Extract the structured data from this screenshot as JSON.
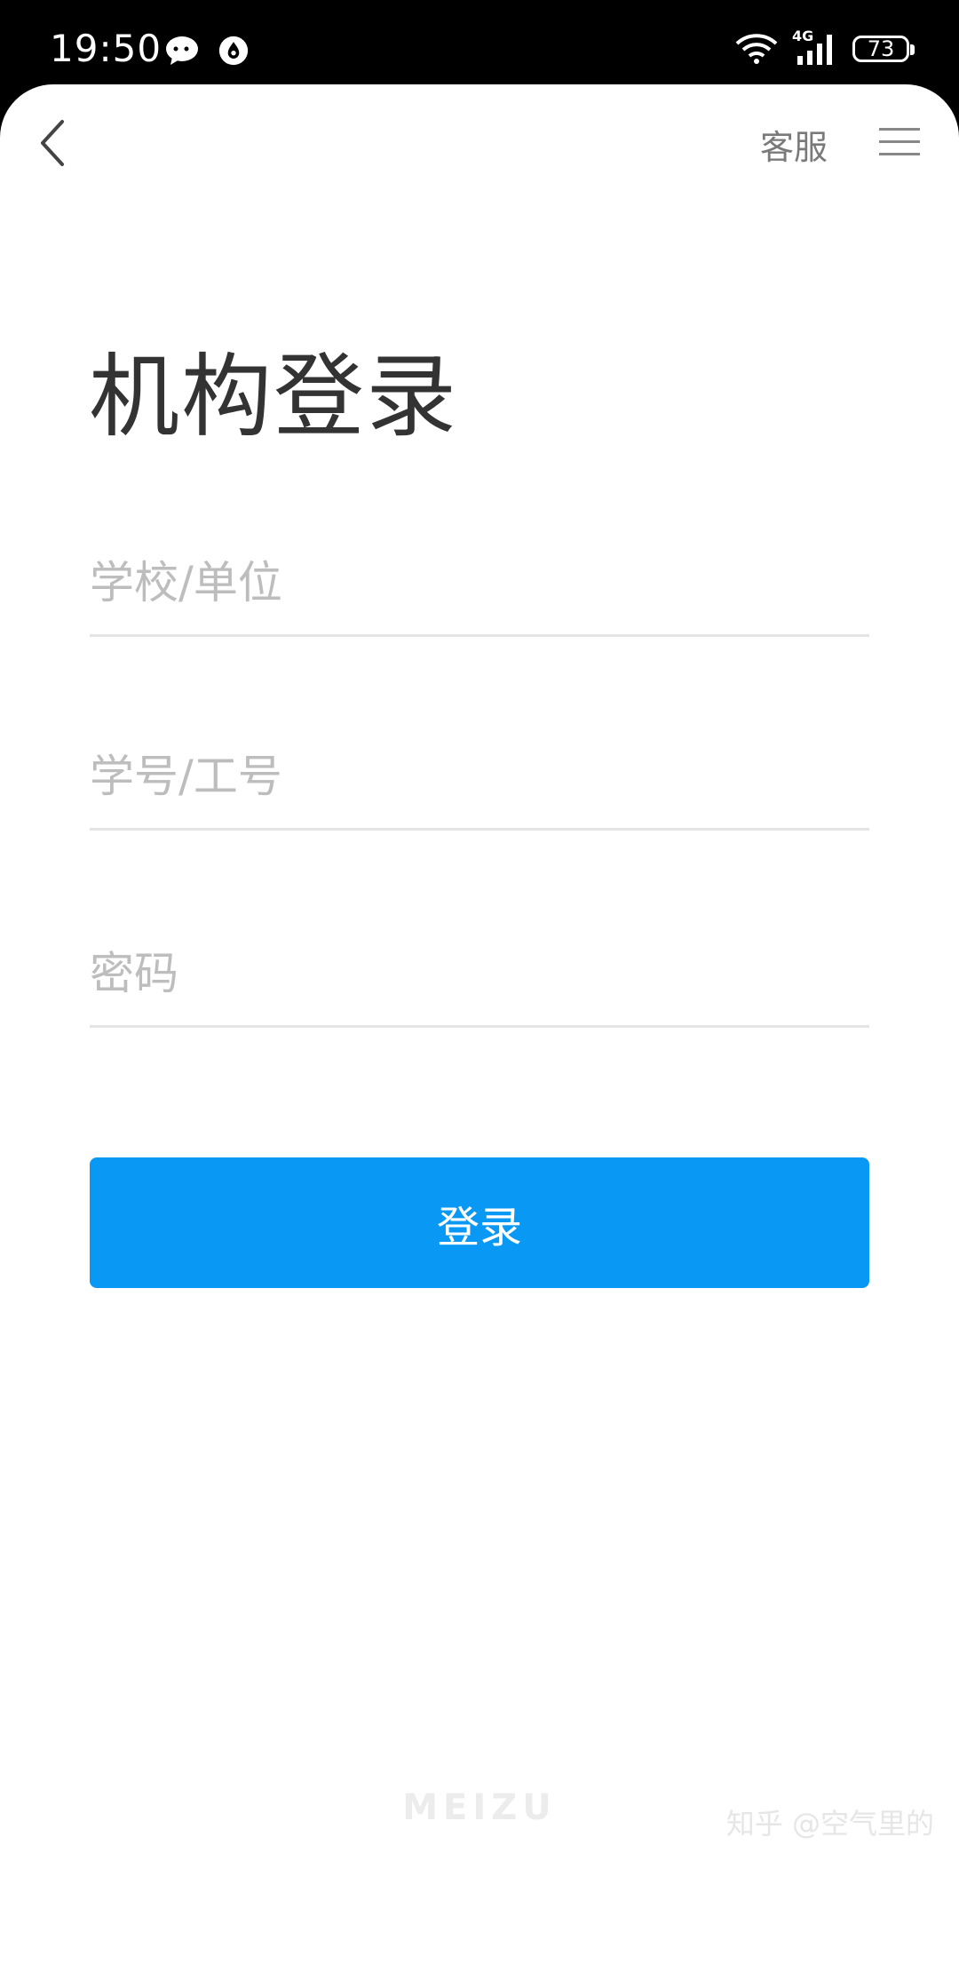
{
  "status_bar": {
    "time": "19:50",
    "network": "4G",
    "battery": "73",
    "icons": [
      "chat-icon",
      "droplet-icon",
      "wifi-icon",
      "signal-icon",
      "battery-icon"
    ]
  },
  "nav": {
    "back_icon": "chevron-left-icon",
    "service_label": "客服",
    "menu_icon": "menu-icon"
  },
  "page": {
    "title": "机构登录"
  },
  "form": {
    "school_placeholder": "学校/单位",
    "id_placeholder": "学号/工号",
    "password_placeholder": "密码",
    "submit_label": "登录"
  },
  "footer": {
    "brand": "MEIZU",
    "watermark": "知乎 @空气里的"
  },
  "colors": {
    "accent": "#0a98f5",
    "title": "#333333",
    "placeholder": "#bdbdbd",
    "divider": "#e4e4e4"
  }
}
